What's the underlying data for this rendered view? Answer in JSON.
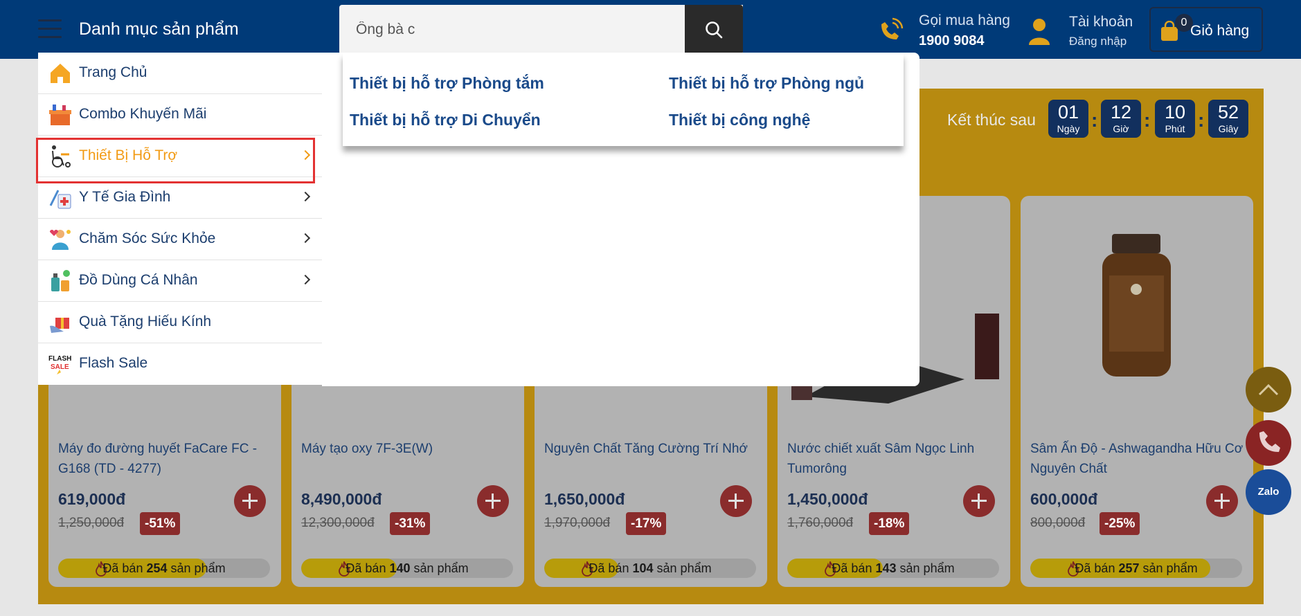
{
  "header": {
    "category_title": "Danh mục sản phẩm",
    "search_value": "Ông bà c",
    "call_label": "Gọi mua hàng",
    "call_number": "1900 9084",
    "account_label": "Tài khoản",
    "account_sub": "Đăng nhập",
    "cart_count": "0",
    "cart_label": "Giỏ hàng"
  },
  "menu": {
    "items": [
      {
        "label": "Trang Chủ",
        "icon": "home-icon",
        "has_sub": false
      },
      {
        "label": "Combo Khuyến Mãi",
        "icon": "gift-box-icon",
        "has_sub": false
      },
      {
        "label": "Thiết Bị Hỗ Trợ",
        "icon": "wheelchair-icon",
        "has_sub": true,
        "active": true
      },
      {
        "label": "Y Tế Gia Đình",
        "icon": "medical-icon",
        "has_sub": true
      },
      {
        "label": "Chăm Sóc Sức Khỏe",
        "icon": "health-care-icon",
        "has_sub": true
      },
      {
        "label": "Đồ Dùng Cá Nhân",
        "icon": "personal-items-icon",
        "has_sub": true
      },
      {
        "label": "Quà Tặng Hiếu Kính",
        "icon": "gift-icon",
        "has_sub": false
      },
      {
        "label": "Flash Sale",
        "icon": "flash-sale-icon",
        "has_sub": false
      }
    ]
  },
  "submenu": {
    "links": [
      "Thiết bị hỗ trợ Phòng tắm",
      "Thiết bị hỗ trợ Phòng ngủ",
      "Thiết bị hỗ trợ Di Chuyển",
      "Thiết bị công nghệ"
    ]
  },
  "countdown": {
    "label": "Kết thúc sau",
    "days": "01",
    "days_unit": "Ngày",
    "hours": "12",
    "hours_unit": "Giờ",
    "minutes": "10",
    "minutes_unit": "Phút",
    "seconds": "52",
    "seconds_unit": "Giây"
  },
  "products": [
    {
      "name": "Máy đo đường huyết FaCare FC - G168 (TD - 4277)",
      "price": "619,000đ",
      "old_price": "1,250,000đ",
      "discount": "-51%",
      "sold_prefix": "Đã bán",
      "sold": "254",
      "sold_suffix": "sản phẩm",
      "sold_fill": 0.7
    },
    {
      "name": "Máy tạo oxy 7F-3E(W)",
      "price": "8,490,000đ",
      "old_price": "12,300,000đ",
      "discount": "-31%",
      "sold_prefix": "Đã bán",
      "sold": "140",
      "sold_suffix": "sản phẩm",
      "sold_fill": 0.45
    },
    {
      "name": "Nguyên Chất Tăng Cường Trí Nhớ",
      "price": "1,650,000đ",
      "old_price": "1,970,000đ",
      "discount": "-17%",
      "sold_prefix": "Đã bán",
      "sold": "104",
      "sold_suffix": "sản phẩm",
      "sold_fill": 0.35
    },
    {
      "name": "Nước chiết xuất Sâm Ngọc Linh Tumorông",
      "price": "1,450,000đ",
      "old_price": "1,760,000đ",
      "discount": "-18%",
      "sold_prefix": "Đã bán",
      "sold": "143",
      "sold_suffix": "sản phẩm",
      "sold_fill": 0.45
    },
    {
      "name": "Sâm Ấn Độ - Ashwagandha Hữu Cơ Nguyên Chất",
      "price": "600,000đ",
      "old_price": "800,000đ",
      "discount": "-25%",
      "sold_prefix": "Đã bán",
      "sold": "257",
      "sold_suffix": "sản phẩm",
      "sold_fill": 0.85
    }
  ],
  "floating": {
    "zalo_label": "Zalo"
  },
  "colors": {
    "header_bg": "#003a78",
    "accent_orange": "#f29b15",
    "link_blue": "#1a4a8a",
    "highlight_red": "#e33232"
  }
}
